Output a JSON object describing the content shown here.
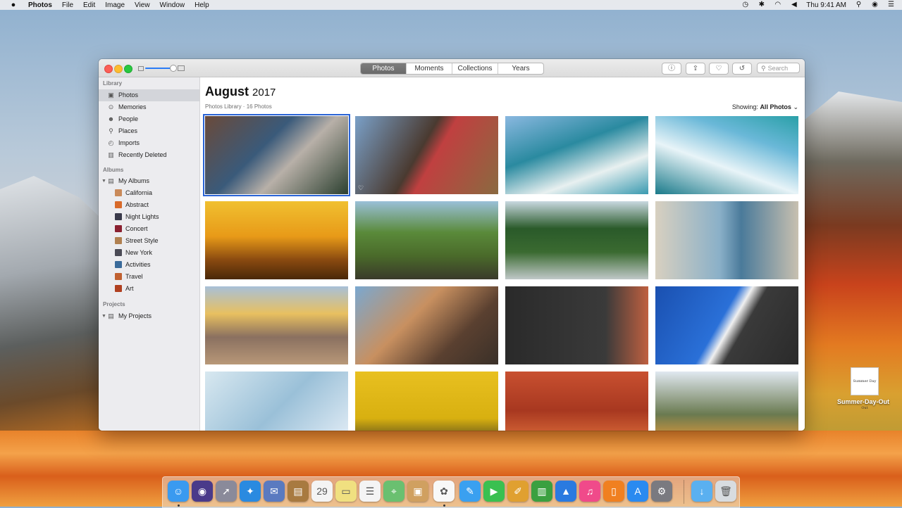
{
  "menubar": {
    "apple_icon": "apple-logo",
    "app_name": "Photos",
    "items": [
      "File",
      "Edit",
      "Image",
      "View",
      "Window",
      "Help"
    ],
    "clock": "Thu 9:41 AM",
    "status_icons": [
      "time-machine-icon",
      "bluetooth-icon",
      "wifi-icon",
      "volume-icon",
      "search-icon",
      "user-icon",
      "notifications-icon"
    ]
  },
  "window": {
    "tabs": [
      {
        "label": "Photos",
        "active": true
      },
      {
        "label": "Moments",
        "active": false
      },
      {
        "label": "Collections",
        "active": false
      },
      {
        "label": "Years",
        "active": false
      }
    ],
    "search_placeholder": "Search"
  },
  "sidebar": {
    "library_heading": "Library",
    "library_items": [
      {
        "label": "Photos",
        "icon": "photos-icon",
        "selected": true
      },
      {
        "label": "Memories",
        "icon": "memories-icon",
        "selected": false
      },
      {
        "label": "People",
        "icon": "people-icon",
        "selected": false
      },
      {
        "label": "Places",
        "icon": "places-icon",
        "selected": false
      },
      {
        "label": "Imports",
        "icon": "imports-icon",
        "selected": false
      },
      {
        "label": "Recently Deleted",
        "icon": "trash-icon",
        "selected": false
      }
    ],
    "albums_heading": "Albums",
    "my_albums_label": "My Albums",
    "albums": [
      {
        "label": "California",
        "color": "#c98a5a"
      },
      {
        "label": "Abstract",
        "color": "#d86a2a"
      },
      {
        "label": "Night Lights",
        "color": "#3a3a4a"
      },
      {
        "label": "Concert",
        "color": "#8a2030"
      },
      {
        "label": "Street Style",
        "color": "#b08050"
      },
      {
        "label": "New York",
        "color": "#4a4a55"
      },
      {
        "label": "Activities",
        "color": "#3a6a9a"
      },
      {
        "label": "Travel",
        "color": "#c06030"
      },
      {
        "label": "Art",
        "color": "#b04020"
      }
    ],
    "projects_heading": "Projects",
    "my_projects_label": "My Projects"
  },
  "content": {
    "month": "August",
    "year": "2017",
    "subtitle": "Photos Library · 16 Photos",
    "showing_label": "Showing:",
    "showing_value": "All Photos",
    "photos": [
      {
        "name": "roller-coaster-friends",
        "bg": "linear-gradient(135deg,#6a4a3a,#3a5a7a 40%,#b8b0a8 60%,#2c4030)",
        "favorite": false,
        "selected": true
      },
      {
        "name": "roller-coaster-back",
        "bg": "linear-gradient(120deg,#7aa0c8,#4a3a30 45%,#c04040 55%,#8a6a40)",
        "favorite": true,
        "selected": false
      },
      {
        "name": "surfer-wave-1",
        "bg": "linear-gradient(160deg,#8ab8e0,#2a8aa0 40%,#e8f0f0 70%,#3a9ab0)",
        "favorite": false,
        "selected": false
      },
      {
        "name": "surfer-wave-2",
        "bg": "linear-gradient(200deg,#2aa0a8,#6ab8d8 30%,#e8f4f8 60%,#1a7a8a)",
        "favorite": false,
        "selected": false
      },
      {
        "name": "golden-sunset",
        "bg": "linear-gradient(180deg,#f0c030,#e89a18 45%,#8a4a10 75%,#4a2808)",
        "favorite": false,
        "selected": false
      },
      {
        "name": "green-pinnacle",
        "bg": "linear-gradient(180deg,#9ac0d8,#5a8a3a 40%,#4a6a2a 70%,#3a3a2a)",
        "favorite": false,
        "selected": false
      },
      {
        "name": "forest-river",
        "bg": "linear-gradient(180deg,#c8d8e0,#2a5a2a 35%,#3a6a30 65%,#c0c8c8)",
        "favorite": false,
        "selected": false
      },
      {
        "name": "coastal-cliffs",
        "bg": "linear-gradient(90deg,#d8d0c0,#8ab0c8 45%,#4a7a9a 60%,#c8c0b0)",
        "favorite": false,
        "selected": false
      },
      {
        "name": "hot-air-balloons",
        "bg": "linear-gradient(180deg,#a8c0d8,#e8c060 35%,#8a7060 65%,#b89878)",
        "favorite": false,
        "selected": false
      },
      {
        "name": "couple-selfie",
        "bg": "linear-gradient(135deg,#7aa8d0,#c89060 40%,#5a4030 70%,#3a3028)",
        "favorite": false,
        "selected": false
      },
      {
        "name": "cyclists-road",
        "bg": "linear-gradient(90deg,#2a2a2a,#3a3a3a 70%,#c06040)",
        "favorite": false,
        "selected": false
      },
      {
        "name": "tennis-court",
        "bg": "linear-gradient(120deg,#1a50b0,#2a70d8 45%,#f0f0f0 52%,#3a3a3a 60%,#2a2a2a)",
        "favorite": false,
        "selected": false
      },
      {
        "name": "glass-facade",
        "bg": "linear-gradient(135deg,#d8e8f0,#9ac0d8 50%,#e8f0f8)",
        "favorite": false,
        "selected": false
      },
      {
        "name": "yellow-wall",
        "bg": "linear-gradient(180deg,#e8c020,#d8b010 60%,#2a2a20)",
        "favorite": false,
        "selected": false
      },
      {
        "name": "red-building",
        "bg": "linear-gradient(180deg,#c85030,#a83820 50%,#e87a40)",
        "favorite": false,
        "selected": false
      },
      {
        "name": "kirkjufell-mountain",
        "bg": "linear-gradient(180deg,#e0e8f0,#6a7a50 55%,#c09040 80%,#3a5a6a)",
        "favorite": false,
        "selected": false
      }
    ]
  },
  "desktop": {
    "file_label": "Summer-Day-Out",
    "file_thumb_text": "Summer Day Out"
  },
  "dock": {
    "apps": [
      {
        "name": "finder",
        "color": "#3a9af0",
        "glyph": "☺",
        "running": true
      },
      {
        "name": "siri",
        "color": "#4a3a8a",
        "glyph": "◉",
        "running": false
      },
      {
        "name": "launchpad",
        "color": "#8a8a9a",
        "glyph": "➚",
        "running": false
      },
      {
        "name": "safari",
        "color": "#2a8ae0",
        "glyph": "✦",
        "running": false
      },
      {
        "name": "mail-stamp",
        "color": "#5a7ac0",
        "glyph": "✉",
        "running": false
      },
      {
        "name": "notes-book",
        "color": "#a87a40",
        "glyph": "▤",
        "running": false
      },
      {
        "name": "calendar",
        "color": "#f4f4f4",
        "glyph": "29",
        "running": false
      },
      {
        "name": "stickies",
        "color": "#f0e080",
        "glyph": "▭",
        "running": false
      },
      {
        "name": "reminders",
        "color": "#f4f4f4",
        "glyph": "☰",
        "running": false
      },
      {
        "name": "maps",
        "color": "#6ac070",
        "glyph": "⌖",
        "running": false
      },
      {
        "name": "preview",
        "color": "#d0a060",
        "glyph": "▣",
        "running": false
      },
      {
        "name": "photos",
        "color": "#f8f8f8",
        "glyph": "✿",
        "running": true
      },
      {
        "name": "messages",
        "color": "#3aa0f0",
        "glyph": "✎",
        "running": false
      },
      {
        "name": "facetime",
        "color": "#3ac050",
        "glyph": "▶",
        "running": false
      },
      {
        "name": "keynote-pages",
        "color": "#e0a030",
        "glyph": "✐",
        "running": false
      },
      {
        "name": "numbers",
        "color": "#3aa040",
        "glyph": "▥",
        "running": false
      },
      {
        "name": "keynote",
        "color": "#2a7ae0",
        "glyph": "▲",
        "running": false
      },
      {
        "name": "itunes",
        "color": "#f04a8a",
        "glyph": "♫",
        "running": false
      },
      {
        "name": "ibooks",
        "color": "#f08020",
        "glyph": "▯",
        "running": false
      },
      {
        "name": "app-store",
        "color": "#2a8af0",
        "glyph": "A",
        "running": false
      },
      {
        "name": "system-preferences",
        "color": "#7a7a80",
        "glyph": "⚙",
        "running": false
      },
      {
        "name": "downloads-folder",
        "color": "#5ab0f0",
        "glyph": "↓",
        "running": false
      },
      {
        "name": "trash",
        "color": "#d8dce0",
        "glyph": "🗑",
        "running": false
      }
    ]
  }
}
